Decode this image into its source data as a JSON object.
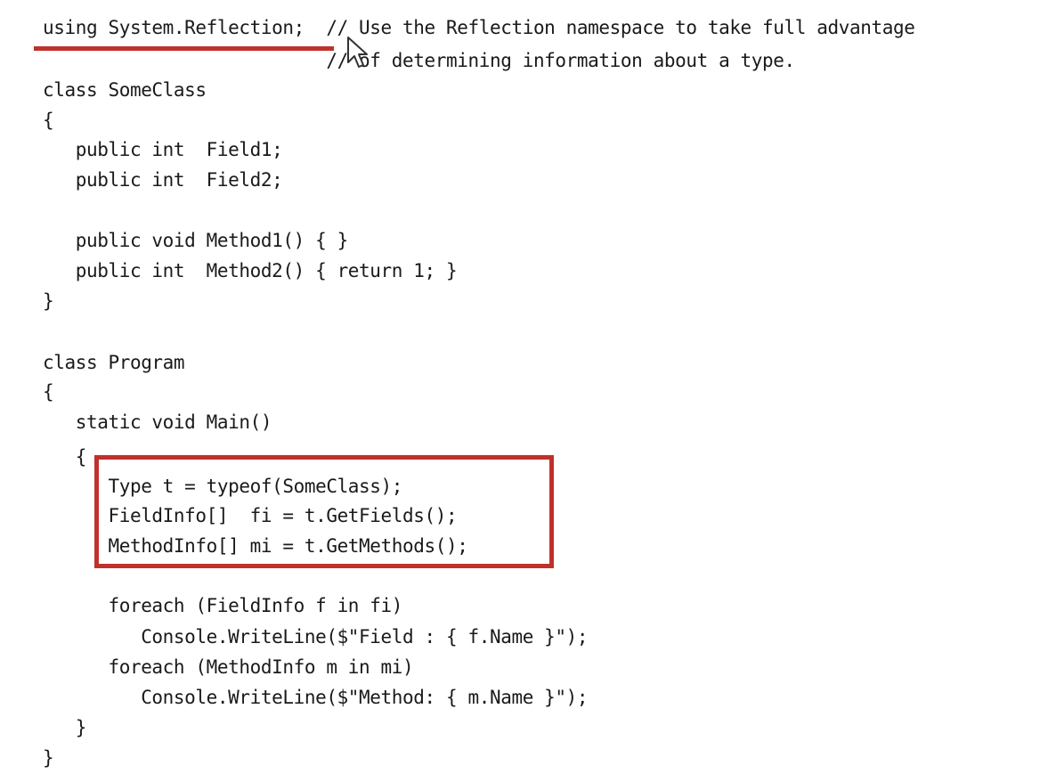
{
  "code": {
    "lines": [
      "using System.Reflection;  // Use the Reflection namespace to take full advantage",
      "                          // of determining information about a type.",
      "class SomeClass",
      "{",
      "   public int  Field1;",
      "   public int  Field2;",
      "",
      "   public void Method1() { }",
      "   public int  Method2() { return 1; }",
      "}",
      "",
      "class Program",
      "{",
      "   static void Main()",
      "   {",
      "      Type t = typeof(SomeClass);",
      "      FieldInfo[]  fi = t.GetFields();",
      "      MethodInfo[] mi = t.GetMethods();",
      "",
      "      foreach (FieldInfo f in fi)",
      "         Console.WriteLine($\"Field : { f.Name }\");",
      "      foreach (MethodInfo m in mi)",
      "         Console.WriteLine($\"Method: { m.Name }\");",
      "   }",
      "}"
    ]
  },
  "annotations": {
    "underline_color": "#c0312b",
    "box_color": "#c0312b",
    "cursor_icon": "mouse-pointer-icon"
  }
}
